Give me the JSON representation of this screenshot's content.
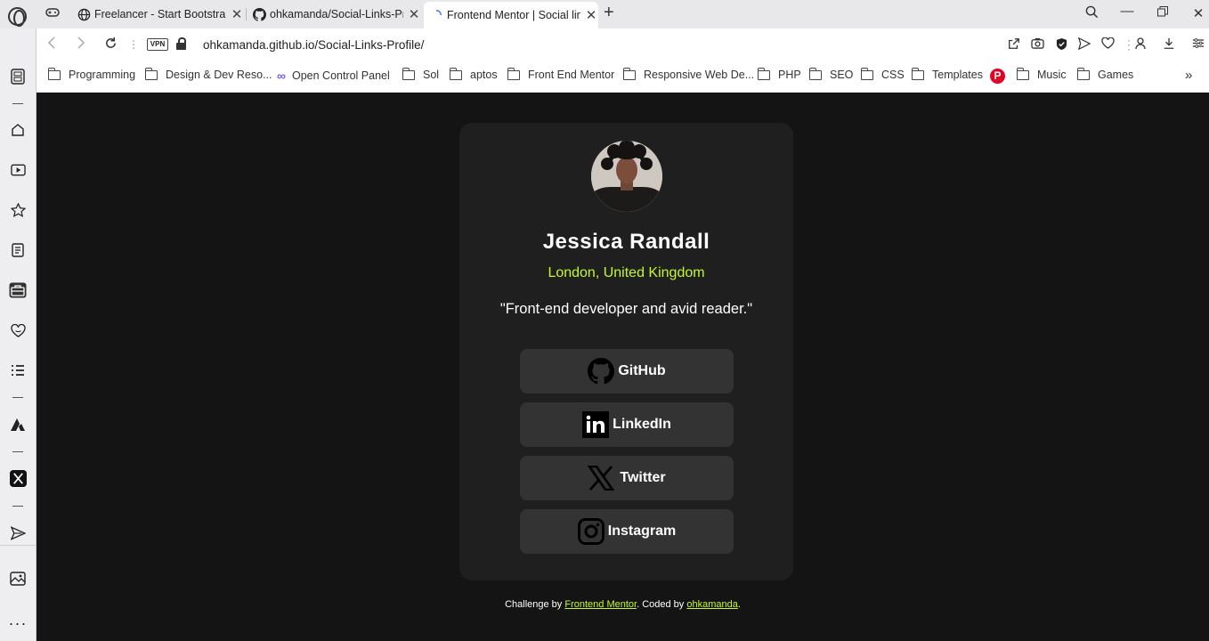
{
  "browser": {
    "tabs": [
      {
        "title": "Freelancer - Start Bootstrap",
        "icon": "globe-icon"
      },
      {
        "title": "ohkamanda/Social-Links-Profile",
        "icon": "github-icon"
      },
      {
        "title": "Frontend Mentor | Social links profile",
        "icon": "loading-icon",
        "active": true
      }
    ],
    "address": {
      "vpn_label": "VPN",
      "url": "ohkamanda.github.io/Social-Links-Profile/"
    },
    "bookmarks": [
      {
        "label": "Programming",
        "icon": "folder-icon"
      },
      {
        "label": "Design & Dev Reso...",
        "icon": "folder-icon"
      },
      {
        "label": "Open Control Panel",
        "icon": "infinity-icon"
      },
      {
        "label": "Sol",
        "icon": "folder-icon"
      },
      {
        "label": "aptos",
        "icon": "folder-icon"
      },
      {
        "label": "Front End Mentor",
        "icon": "folder-icon"
      },
      {
        "label": "Responsive Web De...",
        "icon": "folder-icon"
      },
      {
        "label": "PHP",
        "icon": "folder-icon"
      },
      {
        "label": "SEO",
        "icon": "folder-icon"
      },
      {
        "label": "CSS",
        "icon": "folder-icon"
      },
      {
        "label": "Templates",
        "icon": "folder-icon"
      },
      {
        "label": "",
        "icon": "pinterest-icon"
      },
      {
        "label": "Music",
        "icon": "folder-icon"
      },
      {
        "label": "Games",
        "icon": "folder-icon"
      }
    ]
  },
  "profile": {
    "name": "Jessica Randall",
    "location": "London, United Kingdom",
    "bio": "\"Front-end developer and avid reader.\"",
    "links": [
      {
        "label": "GitHub",
        "icon": "github-icon"
      },
      {
        "label": "LinkedIn",
        "icon": "linkedin-icon"
      },
      {
        "label": "Twitter",
        "icon": "x-icon"
      },
      {
        "label": "Instagram",
        "icon": "instagram-icon"
      }
    ]
  },
  "footer": {
    "prefix": "Challenge by",
    "challenge_link": "Frontend Mentor",
    "middle": ". Coded by",
    "author_link": "ohkamanda",
    "suffix": "."
  },
  "colors": {
    "page_bg": "#141414",
    "card_bg": "#1f1f1f",
    "button_bg": "#333333",
    "accent": "#c4f82a",
    "pinterest": "#e60023"
  }
}
